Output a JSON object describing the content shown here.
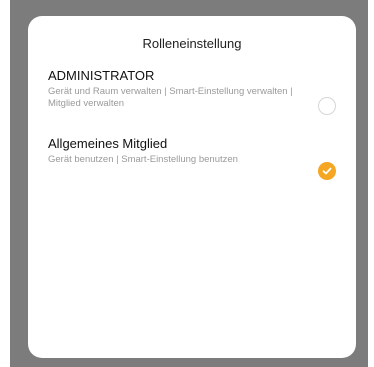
{
  "dialog": {
    "title": "Rolleneinstellung"
  },
  "options": [
    {
      "title": "ADMINISTRATOR",
      "description": "Gerät und Raum verwalten | Smart-Einstellung verwalten | Mitglied verwalten",
      "selected": false
    },
    {
      "title": "Allgemeines Mitglied",
      "description": "Gerät benutzen | Smart-Einstellung benutzen",
      "selected": true
    }
  ],
  "colors": {
    "accent": "#f5a623",
    "backdrop": "#7c7c7c",
    "description_text": "#9a9a9a"
  },
  "icons": {
    "unselected": "radio-empty-icon",
    "selected": "checkmark-circle-icon"
  }
}
